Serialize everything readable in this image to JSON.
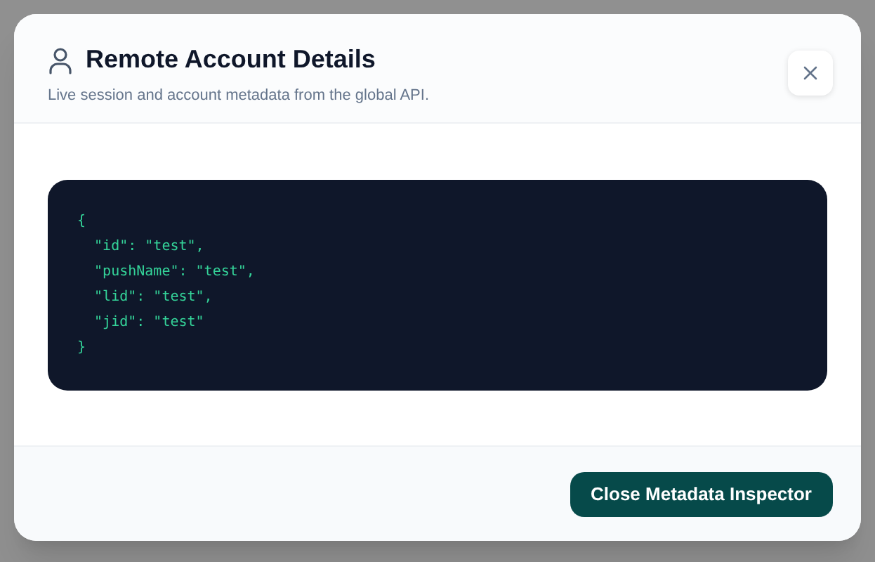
{
  "dialog": {
    "title": "Remote Account Details",
    "subtitle": "Live session and account metadata from the global API.",
    "code_lines": [
      "{",
      "  \"id\": \"test\",",
      "  \"pushName\": \"test\",",
      "  \"lid\": \"test\",",
      "  \"jid\": \"test\"",
      "}"
    ],
    "footer_button": "Close Metadata Inspector"
  }
}
